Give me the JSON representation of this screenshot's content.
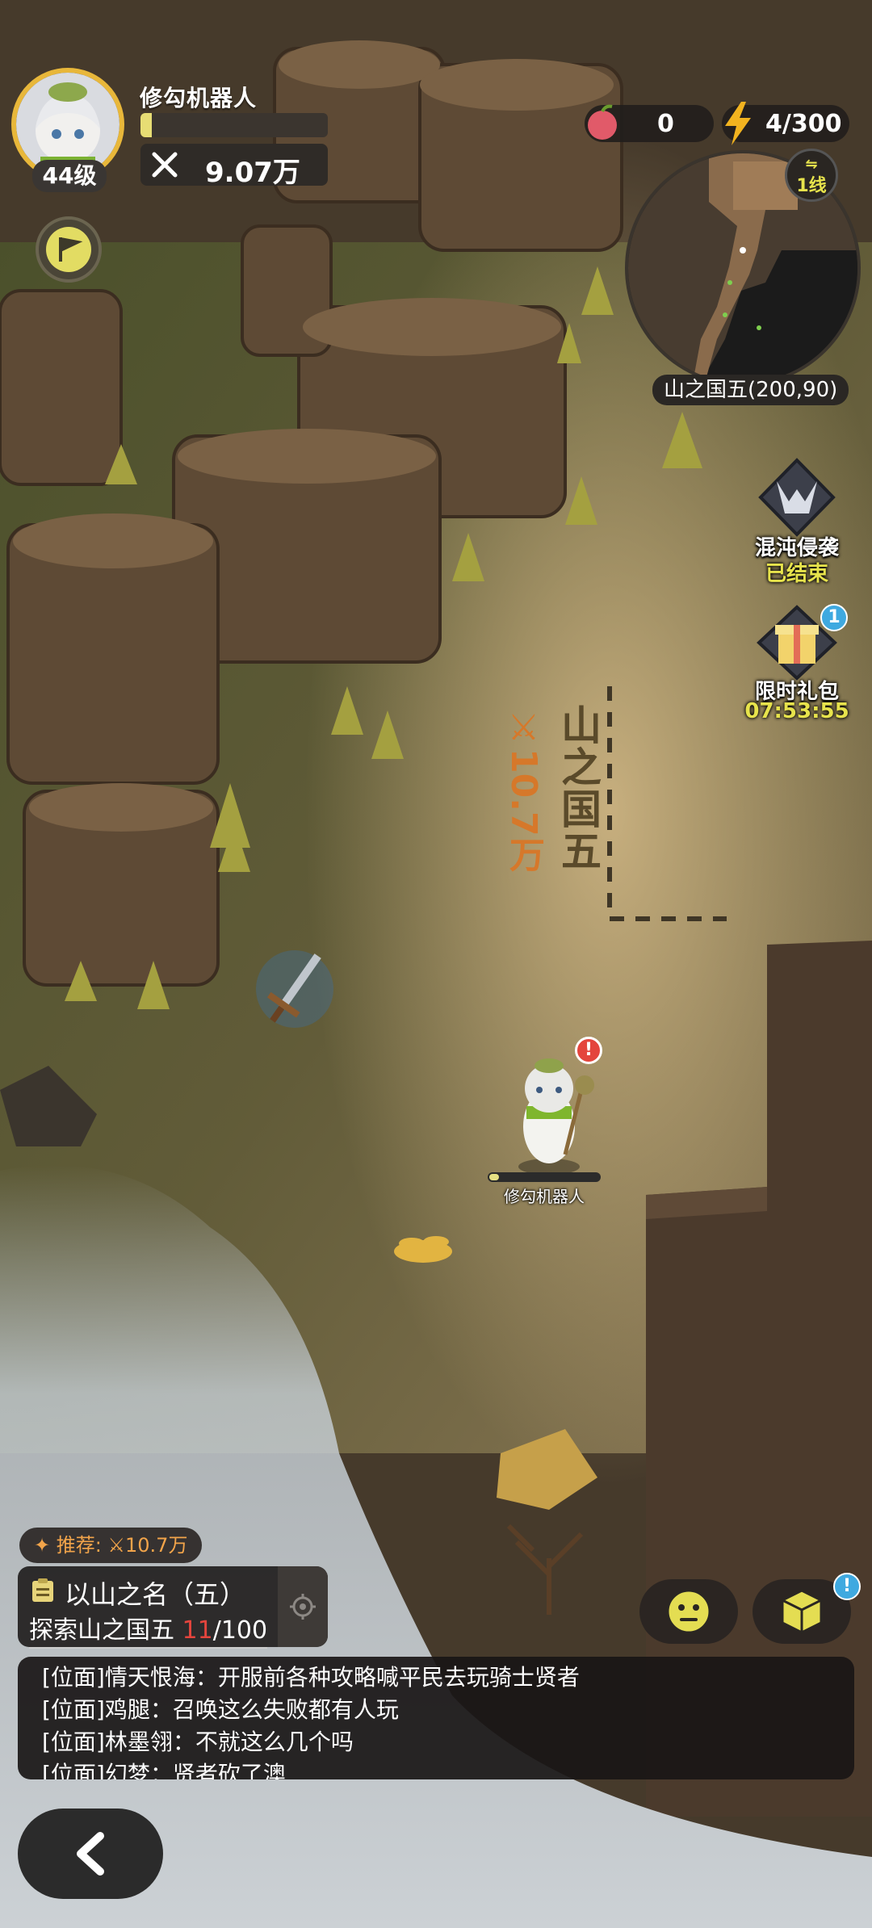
{
  "player": {
    "name": "修勾机器人",
    "level": "44级",
    "power": "9.07万",
    "xp_fraction": 0.06
  },
  "resources": {
    "apples": "0",
    "energy": "4/300"
  },
  "minimap": {
    "line": "1线",
    "line_icon": "swap-arrows-icon",
    "location": "山之国五(200,90)"
  },
  "events": [
    {
      "title": "混沌侵袭",
      "status": "已结束",
      "status_color": "#e7e34c"
    },
    {
      "title": "限时礼包",
      "timer": "07:53:55",
      "badge": "1",
      "timer_color": "#e7e34c"
    }
  ],
  "zone": {
    "name": "山之国五",
    "power": "10.7万"
  },
  "character": {
    "name": "修勾机器人",
    "alert": "!"
  },
  "quest": {
    "recommend_label": "推荐:",
    "recommend_power": "10.7万",
    "title": "以山之名（五）",
    "objective": "探索山之国五",
    "progress_current": "11",
    "progress_total": "/100"
  },
  "chat": {
    "lines": [
      "[位面]情天恨海：开服前各种攻略喊平民去玩骑士贤者",
      "[位面]鸡腿：召唤这么失败都有人玩",
      "[位面]林墨翎：不就这么几个吗",
      "[位面]幻梦：贤者砍了澳"
    ]
  },
  "buttons": {
    "emoji": "emoji-face-icon",
    "box": "cube-icon",
    "box_badge": "!",
    "back": "chevron-left-icon"
  },
  "colors": {
    "accent_gold": "#e8b73a",
    "alert_red": "#e4453d",
    "info_blue": "#3fa9e0",
    "power_orange": "#d6782a"
  }
}
